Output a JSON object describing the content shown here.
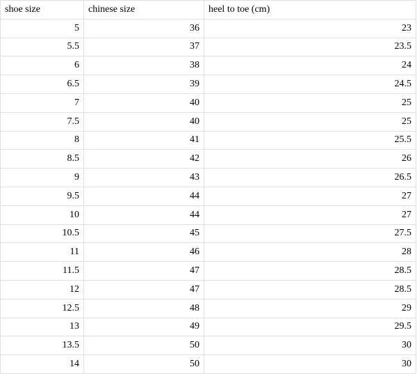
{
  "chart_data": {
    "type": "table",
    "headers": [
      "shoe size",
      "chinese size",
      "heel to toe (cm)"
    ],
    "rows": [
      [
        "5",
        "36",
        "23"
      ],
      [
        "5.5",
        "37",
        "23.5"
      ],
      [
        "6",
        "38",
        "24"
      ],
      [
        "6.5",
        "39",
        "24.5"
      ],
      [
        "7",
        "40",
        "25"
      ],
      [
        "7.5",
        "40",
        "25"
      ],
      [
        "8",
        "41",
        "25.5"
      ],
      [
        "8.5",
        "42",
        "26"
      ],
      [
        "9",
        "43",
        "26.5"
      ],
      [
        "9.5",
        "44",
        "27"
      ],
      [
        "10",
        "44",
        "27"
      ],
      [
        "10.5",
        "45",
        "27.5"
      ],
      [
        "11",
        "46",
        "28"
      ],
      [
        "11.5",
        "47",
        "28.5"
      ],
      [
        "12",
        "47",
        "28.5"
      ],
      [
        "12.5",
        "48",
        "29"
      ],
      [
        "13",
        "49",
        "29.5"
      ],
      [
        "13.5",
        "50",
        "30"
      ],
      [
        "14",
        "50",
        "30"
      ]
    ]
  }
}
